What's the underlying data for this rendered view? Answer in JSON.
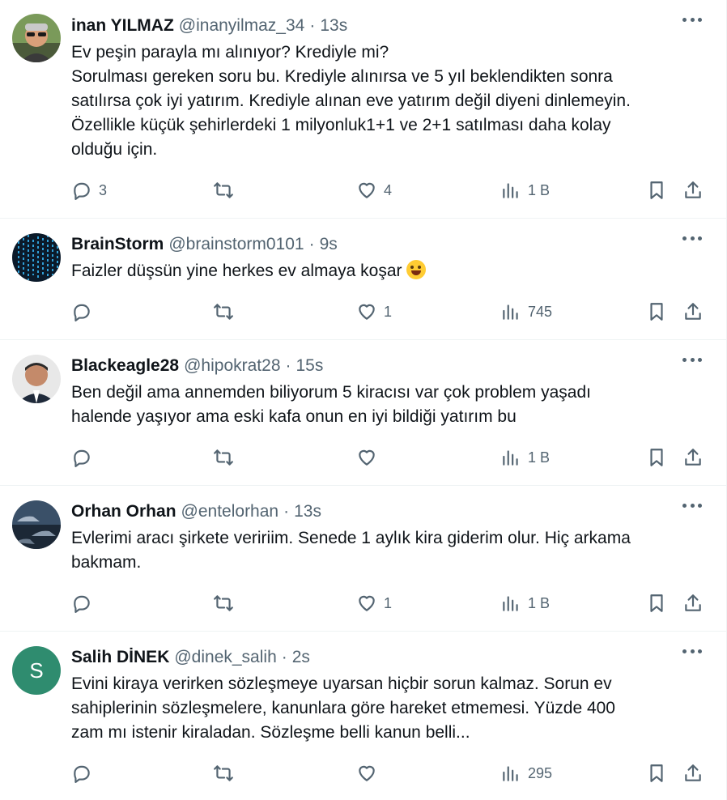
{
  "tweets": [
    {
      "name": "inan YILMAZ",
      "handle": "@inanyilmaz_34",
      "time": "13s",
      "text": "Ev peşin parayla mı alınıyor? Krediyle mi?\nSorulması gereken soru bu. Krediyle alınırsa ve 5 yıl beklendikten sonra\nsatılırsa çok iyi yatırım. Krediyle alınan eve yatırım değil diyeni dinlemeyin.\nÖzellikle küçük şehirlerdeki 1 milyonluk1+1 ve 2+1 satılması daha kolay\nolduğu için.",
      "replies": "3",
      "retweets": "",
      "likes": "4",
      "views": "1 B",
      "avatar_icon": "profile-photo-sunglasses"
    },
    {
      "name": "BrainStorm",
      "handle": "@brainstorm0101",
      "time": "9s",
      "text": "Faizler düşsün yine herkes ev almaya koşar",
      "emoji": "face-with-tears-of-joy",
      "replies": "",
      "retweets": "",
      "likes": "1",
      "views": "745",
      "avatar_icon": "profile-photo-digital-matrix"
    },
    {
      "name": "Blackeagle28",
      "handle": "@hipokrat28",
      "time": "15s",
      "text": "Ben değil ama annemden biliyorum 5 kiracısı var çok problem yaşadı\nhalende yaşıyor ama eski kafa onun en iyi bildiği yatırım bu",
      "replies": "",
      "retweets": "",
      "likes": "",
      "views": "1 B",
      "avatar_icon": "profile-photo-man-suit"
    },
    {
      "name": "Orhan Orhan",
      "handle": "@entelorhan",
      "time": "13s",
      "text": "Evlerimi aracı şirkete veririim. Senede 1 aylık kira giderim olur. Hiç arkama\nbakmam.",
      "replies": "",
      "retweets": "",
      "likes": "1",
      "views": "1 B",
      "avatar_icon": "profile-photo-cars"
    },
    {
      "name": "Salih DİNEK",
      "handle": "@dinek_salih",
      "time": "2s",
      "text": "Evini kiraya verirken sözleşmeye uyarsan hiçbir sorun kalmaz. Sorun ev\nsahiplerinin sözleşmelere, kanunlara göre hareket etmemesi. Yüzde 400\nzam mı istenir kiraladan. Sözleşme belli kanun belli...",
      "replies": "",
      "retweets": "",
      "likes": "",
      "views": "295",
      "avatar_letter": "S",
      "avatar_color": "#2f8c6f"
    }
  ],
  "separator": "·",
  "colors": {
    "text_primary": "#0f1419",
    "text_secondary": "#536471",
    "divider": "#eff3f4"
  }
}
